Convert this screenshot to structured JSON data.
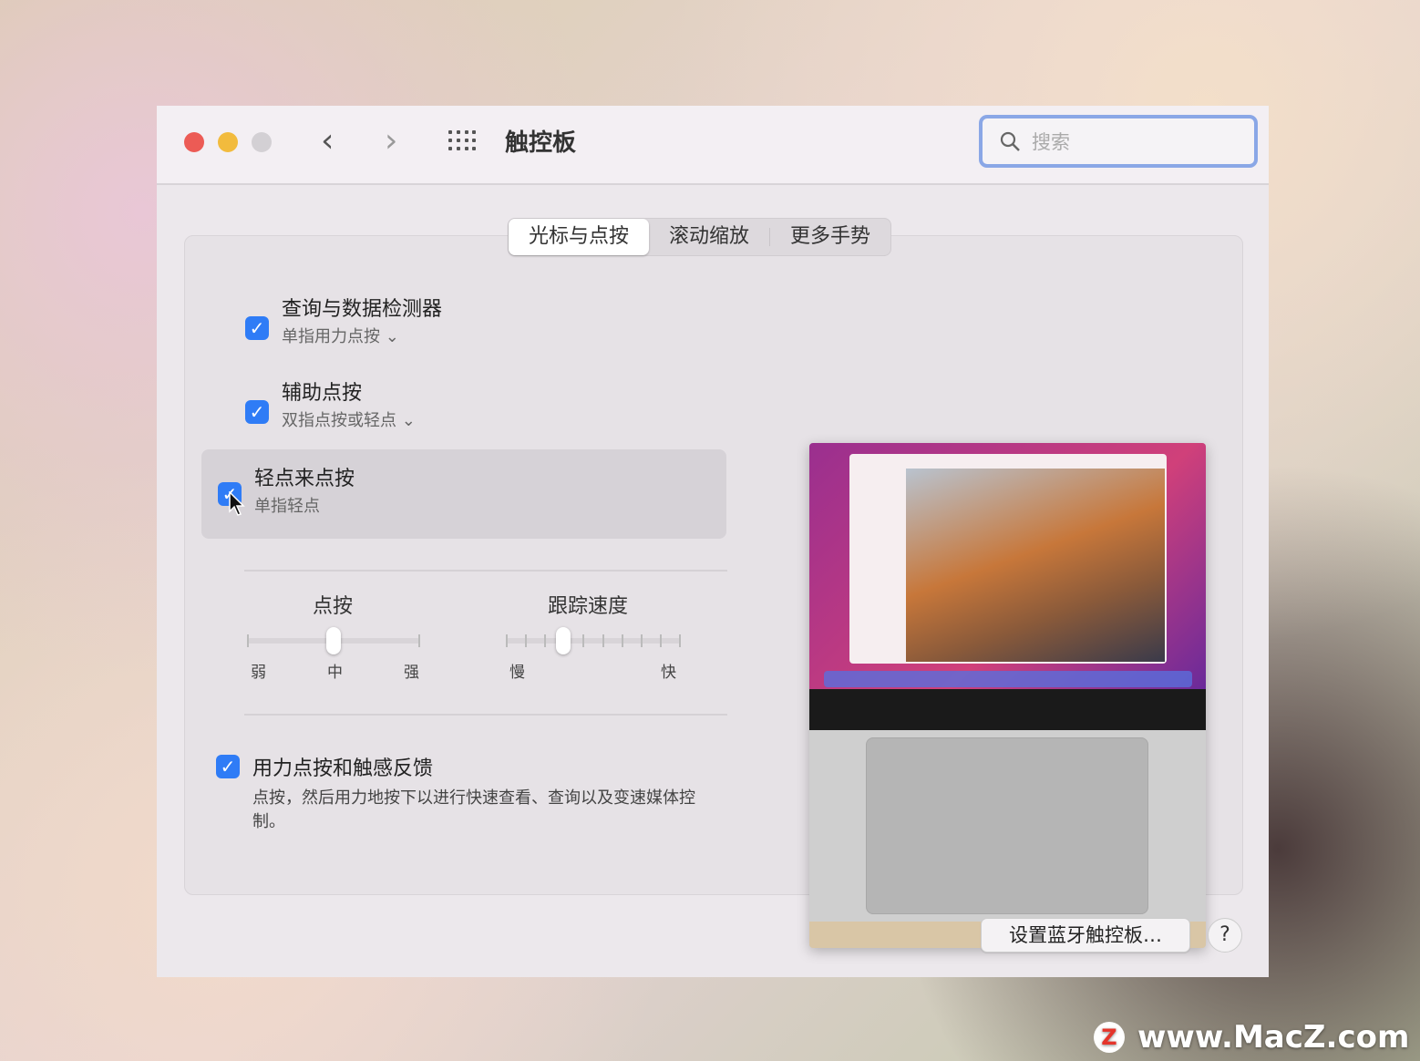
{
  "window": {
    "title": "触控板",
    "search_placeholder": "搜索",
    "traffic_lights": {
      "close": "#ec5b55",
      "minimize": "#f2bb3d",
      "zoom": "#d3d0d4"
    }
  },
  "tabs": [
    {
      "label": "光标与点按",
      "active": true
    },
    {
      "label": "滚动缩放",
      "active": false
    },
    {
      "label": "更多手势",
      "active": false
    }
  ],
  "options": [
    {
      "label": "查询与数据检测器",
      "sub": "单指用力点按",
      "checked": true,
      "has_dropdown": true
    },
    {
      "label": "辅助点按",
      "sub": "双指点按或轻点",
      "checked": true,
      "has_dropdown": true
    },
    {
      "label": "轻点来点按",
      "sub": "单指轻点",
      "checked": true,
      "has_dropdown": false
    }
  ],
  "click_slider": {
    "title": "点按",
    "labels": [
      "弱",
      "中",
      "强"
    ],
    "value_fraction": 0.5
  },
  "tracking_slider": {
    "title": "跟踪速度",
    "min_label": "慢",
    "max_label": "快",
    "value_fraction": 0.33
  },
  "force_click": {
    "label": "用力点按和触感反馈",
    "checked": true,
    "description": "点按，然后用力地按下以进行快速查看、查询以及变速媒体控制。"
  },
  "footer": {
    "bluetooth_button": "设置蓝牙触控板…",
    "help": "?"
  },
  "accent": "#2f7cf6",
  "watermark": "www.MacZ.com"
}
